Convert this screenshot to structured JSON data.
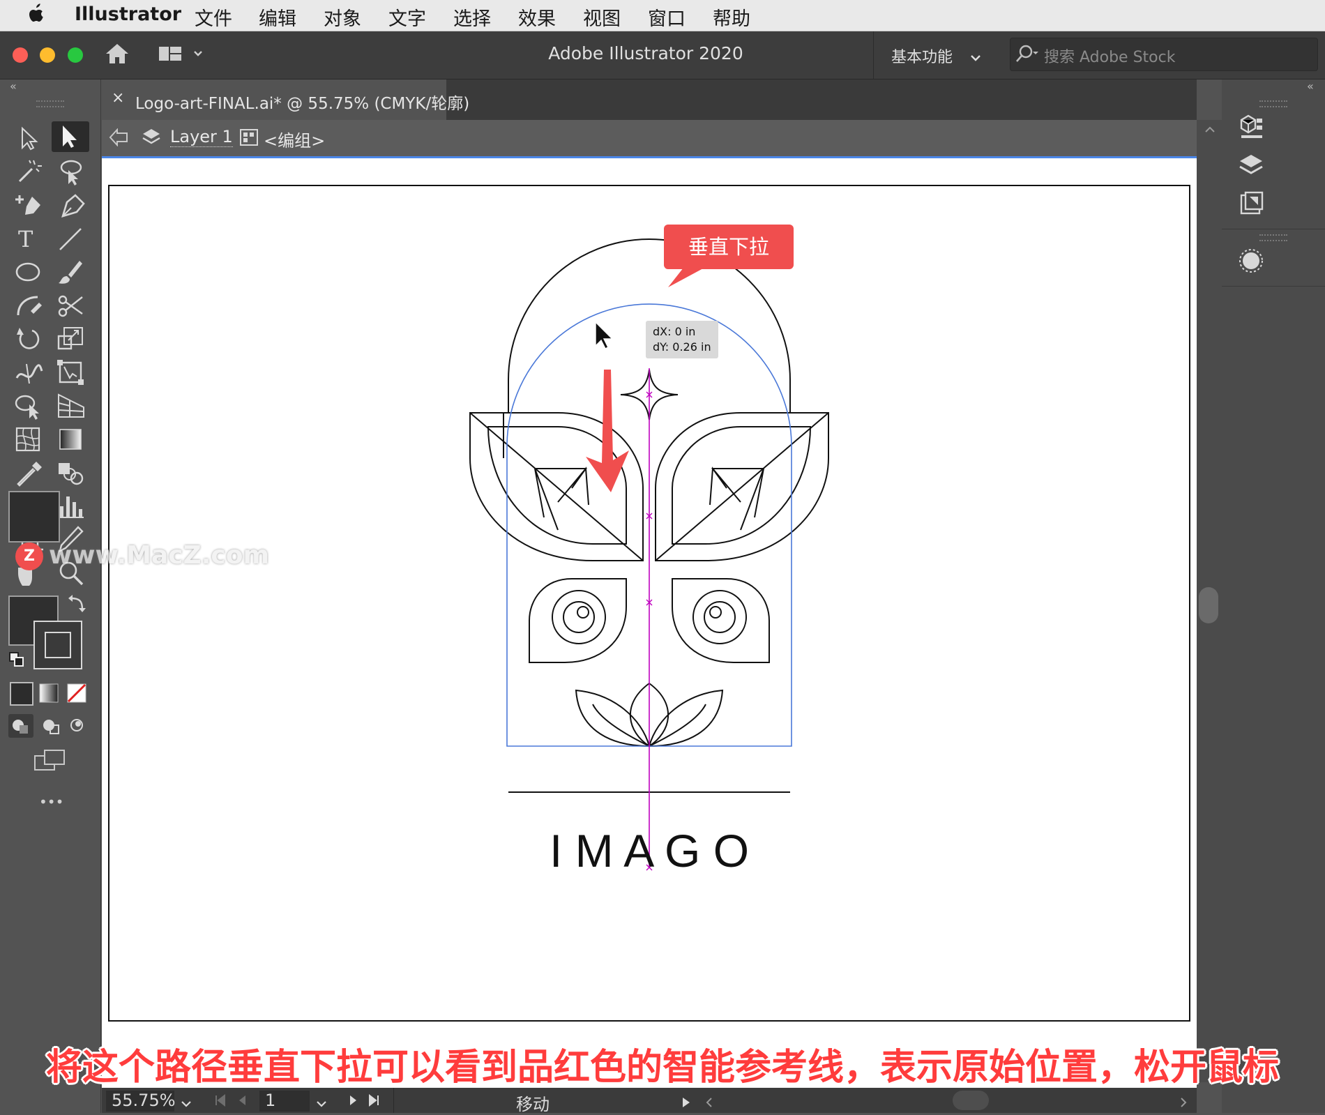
{
  "menubar": {
    "app_name": "Illustrator",
    "items": [
      "文件",
      "编辑",
      "对象",
      "文字",
      "选择",
      "效果",
      "视图",
      "窗口",
      "帮助"
    ]
  },
  "window": {
    "title": "Adobe Illustrator 2020",
    "workspace": "基本功能",
    "search_placeholder": "搜索 Adobe Stock"
  },
  "document_tab": {
    "close_glyph": "×",
    "label": "Logo-art-FINAL.ai* @ 55.75% (CMYK/轮廓)"
  },
  "breadcrumb": {
    "layer": "Layer 1",
    "group": "<编组>"
  },
  "toolbar": {
    "more_label": "•••"
  },
  "watermark": {
    "text": "www.MacZ.com",
    "badge": "Z"
  },
  "artwork": {
    "callout": "垂直下拉",
    "tooltip_dx": "dX: 0 in",
    "tooltip_dy": "dY: 0.26 in",
    "logo_text": "I M A G O"
  },
  "status": {
    "zoom": "55.75%",
    "artboard": "1",
    "mode": "移动"
  },
  "caption": "将这个路径垂直下拉可以看到品红色的智能参考线，表示原始位置，松开鼠标",
  "colors": {
    "accent_red": "#f04e4e",
    "selection_blue": "#4a78d8",
    "smart_guide_magenta": "#c000c0"
  }
}
